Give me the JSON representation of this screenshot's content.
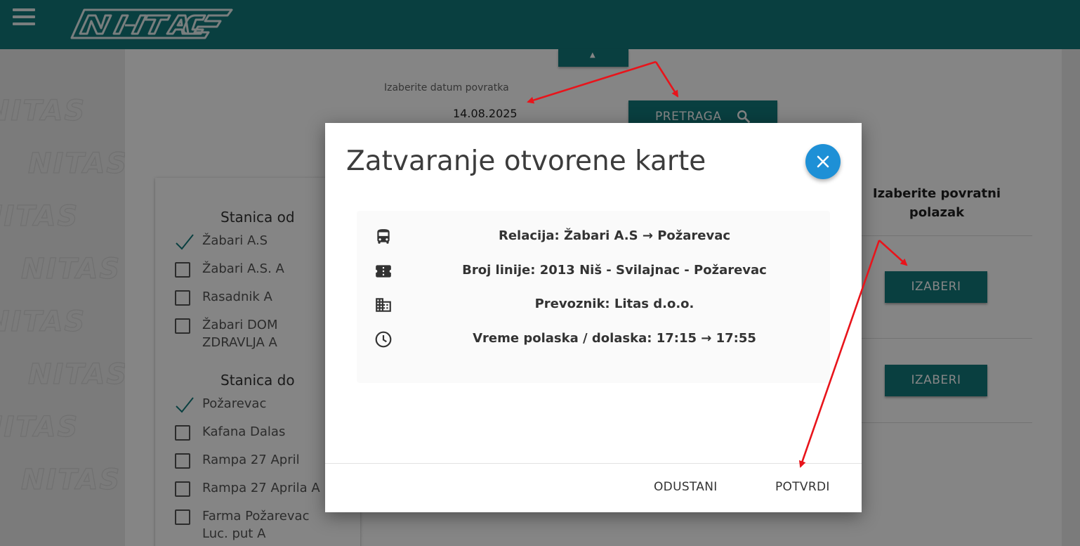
{
  "header": {
    "logo_icon": "nitas-logo",
    "accent_color": "#137a7c"
  },
  "page": {
    "return_date_label": "Izaberite datum povratka",
    "return_date_value": "14.08.2025",
    "search_button_label": "PRETRAGA",
    "return_departure_heading": "Izaberite povratni polazak",
    "select_button_label": "IZABERI"
  },
  "filters": {
    "from_title": "Stanica od",
    "from_items": [
      {
        "label": "Žabari A.S",
        "checked": true
      },
      {
        "label": "Žabari A.S. A",
        "checked": false
      },
      {
        "label": "Rasadnik A",
        "checked": false
      },
      {
        "label": "Žabari DOM ZDRAVLJA A",
        "checked": false
      }
    ],
    "to_title": "Stanica do",
    "to_items": [
      {
        "label": "Požarevac",
        "checked": true
      },
      {
        "label": "Kafana Dalas",
        "checked": false
      },
      {
        "label": "Rampa 27 April",
        "checked": false
      },
      {
        "label": "Rampa 27 Aprila A",
        "checked": false
      },
      {
        "label": "Farma Požarevac Luc. put A",
        "checked": false
      }
    ]
  },
  "modal": {
    "title": "Zatvaranje otvorene karte",
    "close_color": "#1e90d6",
    "rows": [
      {
        "icon": "bus-icon",
        "text": "Relacija: Žabari A.S → Požarevac"
      },
      {
        "icon": "ticket-icon",
        "text": "Broj linije: 2013 Niš - Svilajnac - Požarevac"
      },
      {
        "icon": "building-icon",
        "text": "Prevoznik: Litas d.o.o."
      },
      {
        "icon": "clock-icon",
        "text": "Vreme polaska / dolaska: 17:15 → 17:55"
      }
    ],
    "cancel_label": "ODUSTANI",
    "confirm_label": "POTVRDI"
  },
  "annotations": {
    "arrow_color": "#e8141b"
  }
}
